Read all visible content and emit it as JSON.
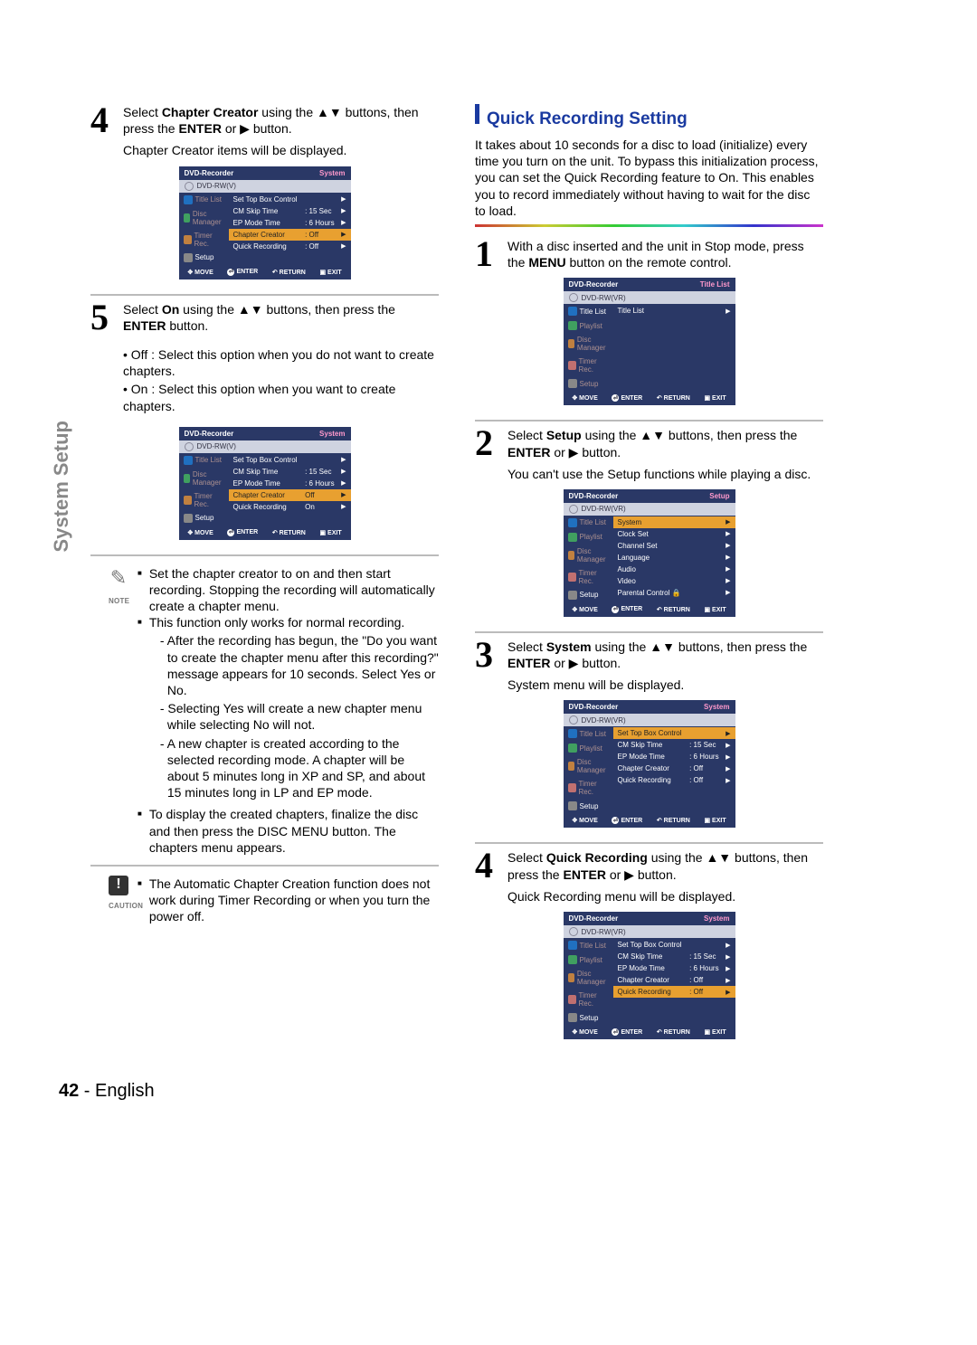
{
  "page": {
    "number": "42",
    "lang": "English"
  },
  "side_tab": "System Setup",
  "left": {
    "step4": {
      "t1": "Select ",
      "t2": "Chapter Creator",
      "t3": " using the ▲▼ buttons, then press the ",
      "t4": "ENTER",
      "t5": " or ▶ button.",
      "sub": "Chapter Creator items will be displayed."
    },
    "step5": {
      "t1": "Select ",
      "t2": "On",
      "t3": " using the ▲▼ buttons, then press the ",
      "t4": "ENTER",
      "t5": " button.",
      "off_label": "Off :",
      "off_text": " Select this option when you do not want to create chapters.",
      "on_label": "On :",
      "on_text": " Select this option when you want to create chapters."
    },
    "note_label": "NOTE",
    "note_items": {
      "i1": "Set the chapter creator to on and then start recording. Stopping the recording will automatically create a chapter menu.",
      "i2": "This function only works for normal recording.",
      "i2a": "After the recording has begun, the \"Do you want to create the chapter menu after this recording?\" message appears for 10 seconds. Select ",
      "i2a_b1": "Yes",
      "i2a_mid": " or ",
      "i2a_b2": "No",
      "i2a_end": ".",
      "i2b": "Selecting Yes will create a new chapter menu while selecting No will not.",
      "i2b_prefix": "Selecting ",
      "i2b_b1": "Yes",
      "i2b_mid": " will create a new chapter menu while selecting ",
      "i2b_b2": "No",
      "i2b_end": " will not.",
      "i2c": "A new chapter is created according to the selected recording mode. A chapter will be about 5 minutes long in XP and SP, and about 15 minutes long in LP and EP mode.",
      "i3_pre": "To display the created chapters, finalize the disc and then press the ",
      "i3_b": "DISC MENU",
      "i3_post": " button. The chapters menu appears."
    },
    "caution_label": "CAUTION",
    "caution_text": "The Automatic Chapter Creation function does not work during Timer Recording or when you turn the power off."
  },
  "right": {
    "heading": "Quick Recording Setting",
    "intro": "It takes about 10 seconds for a disc to load (initialize) every time you turn on the unit. To bypass this initialization process, you can set the Quick Recording feature to On. This enables you to record immediately without having to wait for the disc to load.",
    "step1": {
      "pre": "With a disc inserted and the unit in Stop mode, press the ",
      "b": "MENU",
      "post": " button on the remote control."
    },
    "step2": {
      "pre": "Select ",
      "b1": "Setup",
      "mid": " using the ▲▼ buttons, then press the ",
      "b2": "ENTER",
      "post": " or ▶ button.",
      "sub": "You can't use the Setup functions while playing a disc."
    },
    "step3": {
      "pre": "Select ",
      "b1": "System",
      "mid": " using the ▲▼ buttons, then press the ",
      "b2": "ENTER",
      "post": " or ▶ button.",
      "sub": "System menu will be displayed."
    },
    "step4": {
      "pre": "Select ",
      "b1": "Quick Recording",
      "mid": " using the ▲▼ buttons, then press the ",
      "b2": "ENTER",
      "post": " or ▶ button.",
      "sub": "Quick Recording menu will be displayed."
    }
  },
  "osd_common": {
    "record": "DVD-Recorder",
    "disc_v": "DVD-RW(V)",
    "disc_vr": "DVD-RW(VR)",
    "title_list": "Title List",
    "playlist": "Playlist",
    "disc_manager": "Disc Manager",
    "timer_rec": "Timer Rec.",
    "setup": "Setup",
    "move": "MOVE",
    "enter": "ENTER",
    "return": "RETURN",
    "exit": "EXIT"
  },
  "osdA": {
    "breadcrumb": "System",
    "items": [
      {
        "t": "Set Top Box Control",
        "v": ""
      },
      {
        "t": "CM Skip Time",
        "v": ": 15 Sec"
      },
      {
        "t": "EP Mode Time",
        "v": ": 6 Hours"
      },
      {
        "t": "Chapter Creator",
        "v": ": Off",
        "sel": true
      },
      {
        "t": "Quick Recording",
        "v": ": Off"
      }
    ]
  },
  "osdB": {
    "breadcrumb": "System",
    "items": [
      {
        "t": "Set Top Box Control",
        "v": ""
      },
      {
        "t": "CM Skip Time",
        "v": ": 15 Sec"
      },
      {
        "t": "EP Mode Time",
        "v": ": 6 Hours"
      },
      {
        "t": "Chapter Creator",
        "v": "Off",
        "sel": true
      },
      {
        "t": "Quick Recording",
        "v": "On",
        "box": true
      }
    ]
  },
  "osdC": {
    "breadcrumb": "Title List",
    "single": "Title List"
  },
  "osdD": {
    "breadcrumb": "Setup",
    "items": [
      {
        "t": "System",
        "sel": true
      },
      {
        "t": "Clock Set"
      },
      {
        "t": "Channel Set"
      },
      {
        "t": "Language"
      },
      {
        "t": "Audio"
      },
      {
        "t": "Video"
      },
      {
        "t": "Parental Control  🔒"
      }
    ]
  },
  "osdE": {
    "breadcrumb": "System",
    "items": [
      {
        "t": "Set Top Box Control",
        "v": "",
        "sel": true
      },
      {
        "t": "CM Skip Time",
        "v": ": 15 Sec"
      },
      {
        "t": "EP Mode Time",
        "v": ": 6 Hours"
      },
      {
        "t": "Chapter Creator",
        "v": ": Off"
      },
      {
        "t": "Quick Recording",
        "v": ": Off"
      }
    ]
  },
  "osdF": {
    "breadcrumb": "System",
    "items": [
      {
        "t": "Set Top Box Control",
        "v": ""
      },
      {
        "t": "CM Skip Time",
        "v": ": 15 Sec"
      },
      {
        "t": "EP Mode Time",
        "v": ": 6 Hours"
      },
      {
        "t": "Chapter Creator",
        "v": ": Off"
      },
      {
        "t": "Quick Recording",
        "v": ": Off",
        "sel": true
      }
    ]
  }
}
